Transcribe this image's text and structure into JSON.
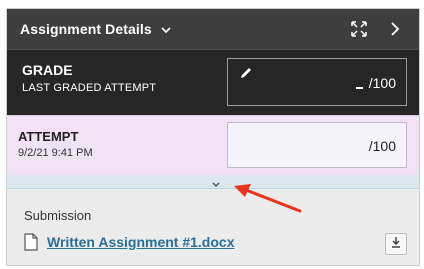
{
  "header": {
    "title": "Assignment Details",
    "title_icon": "chevron-down-icon",
    "actions": [
      {
        "icon": "expand-icon"
      },
      {
        "icon": "chevron-right-icon"
      }
    ]
  },
  "grade": {
    "title": "GRADE",
    "subtitle": "LAST GRADED ATTEMPT",
    "edit_icon": "pencil-icon",
    "value": "/100"
  },
  "attempt": {
    "title": "ATTEMPT",
    "date": "9/2/21 9:41 PM",
    "value": "/100"
  },
  "expand": {
    "icon": "chevron-down-icon"
  },
  "submission": {
    "label": "Submission",
    "file_icon": "document-icon",
    "file_name": "Written Assignment #1.docx",
    "download_icon": "download-icon"
  },
  "annotation": {
    "icon": "red-arrow-icon",
    "color": "#e8341c"
  },
  "colors": {
    "header_bg": "#3e3e3e",
    "grade_bg": "#262626",
    "attempt_bg": "#f2e2f6",
    "link": "#2a6f9a"
  }
}
